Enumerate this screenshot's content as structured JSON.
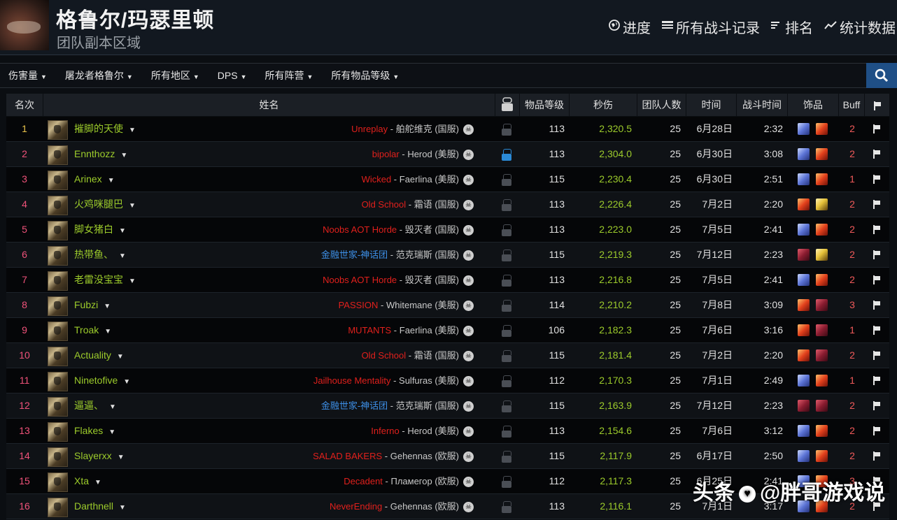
{
  "header": {
    "title": "格鲁尔/玛瑟里顿",
    "subtitle": "团队副本区域",
    "nav": [
      {
        "label": "进度",
        "icon": "globe-icon"
      },
      {
        "label": "所有战斗记录",
        "icon": "list-icon"
      },
      {
        "label": "排名",
        "icon": "ranking-icon"
      },
      {
        "label": "统计数据",
        "icon": "chart-line-icon"
      }
    ]
  },
  "filters": [
    "伤害量",
    "屠龙者格鲁尔",
    "所有地区",
    "DPS",
    "所有阵营",
    "所有物品等级"
  ],
  "table": {
    "columns": [
      "名次",
      "姓名",
      "物品等级",
      "秒伤",
      "团队人数",
      "时间",
      "战斗时间",
      "饰品",
      "Buff"
    ],
    "rows": [
      {
        "rank": "1",
        "name": "摧脚的天使",
        "guild": "Unreplay",
        "server": "舶舵维克 (国服)",
        "video": false,
        "ilvl": "113",
        "dps": "2,320.5",
        "raid": "25",
        "date": "6月28日",
        "fight": "2:32",
        "gems": [
          "blue",
          "red"
        ],
        "buff": "2"
      },
      {
        "rank": "2",
        "name": "Ennthozz",
        "guild": "bipolar",
        "server": "Herod (美服)",
        "video": true,
        "ilvl": "113",
        "dps": "2,304.0",
        "raid": "25",
        "date": "6月30日",
        "fight": "3:08",
        "gems": [
          "blue",
          "red"
        ],
        "buff": "2"
      },
      {
        "rank": "3",
        "name": "Arinex",
        "guild": "Wicked",
        "server": "Faerlina (美服)",
        "video": false,
        "ilvl": "115",
        "dps": "2,230.4",
        "raid": "25",
        "date": "6月30日",
        "fight": "2:51",
        "gems": [
          "blue",
          "red"
        ],
        "buff": "1"
      },
      {
        "rank": "4",
        "name": "火鸡咪腿巴",
        "guild": "Old School",
        "server": "霜语 (国服)",
        "video": false,
        "ilvl": "113",
        "dps": "2,226.4",
        "raid": "25",
        "date": "7月2日",
        "fight": "2:20",
        "gems": [
          "red",
          "yellow"
        ],
        "buff": "2"
      },
      {
        "rank": "5",
        "name": "脚女猪白",
        "guild": "Noobs AOT Horde",
        "server": "毁灭者 (国服)",
        "video": false,
        "ilvl": "113",
        "dps": "2,223.0",
        "raid": "25",
        "date": "7月5日",
        "fight": "2:41",
        "gems": [
          "blue",
          "red"
        ],
        "buff": "2"
      },
      {
        "rank": "6",
        "name": "热带鱼、",
        "guild": "金融世家-神话团",
        "server": "范克瑞斯 (国服)",
        "video": false,
        "ilvl": "115",
        "dps": "2,219.3",
        "raid": "25",
        "date": "7月12日",
        "fight": "2:23",
        "gems": [
          "maroon",
          "yellow"
        ],
        "buff": "2"
      },
      {
        "rank": "7",
        "name": "老雷没宝宝",
        "guild": "Noobs AOT Horde",
        "server": "毁灭者 (国服)",
        "video": false,
        "ilvl": "113",
        "dps": "2,216.8",
        "raid": "25",
        "date": "7月5日",
        "fight": "2:41",
        "gems": [
          "blue",
          "red"
        ],
        "buff": "2"
      },
      {
        "rank": "8",
        "name": "Fubzi",
        "guild": "PASSION",
        "server": "Whitemane (美服)",
        "video": false,
        "ilvl": "114",
        "dps": "2,210.2",
        "raid": "25",
        "date": "7月8日",
        "fight": "3:09",
        "gems": [
          "red",
          "maroon"
        ],
        "buff": "3"
      },
      {
        "rank": "9",
        "name": "Troak",
        "guild": "MUTANTS",
        "server": "Faerlina (美服)",
        "video": false,
        "ilvl": "106",
        "dps": "2,182.3",
        "raid": "25",
        "date": "7月6日",
        "fight": "3:16",
        "gems": [
          "red",
          "maroon"
        ],
        "buff": "1"
      },
      {
        "rank": "10",
        "name": "Actuality",
        "guild": "Old School",
        "server": "霜语 (国服)",
        "video": false,
        "ilvl": "115",
        "dps": "2,181.4",
        "raid": "25",
        "date": "7月2日",
        "fight": "2:20",
        "gems": [
          "red",
          "maroon"
        ],
        "buff": "2"
      },
      {
        "rank": "11",
        "name": "Ninetofive",
        "guild": "Jailhouse Mentality",
        "server": "Sulfuras (美服)",
        "video": false,
        "ilvl": "112",
        "dps": "2,170.3",
        "raid": "25",
        "date": "7月1日",
        "fight": "2:49",
        "gems": [
          "blue",
          "red"
        ],
        "buff": "1"
      },
      {
        "rank": "12",
        "name": "逼逼、",
        "guild": "金融世家-神话团",
        "server": "范克瑞斯 (国服)",
        "video": false,
        "ilvl": "115",
        "dps": "2,163.9",
        "raid": "25",
        "date": "7月12日",
        "fight": "2:23",
        "gems": [
          "maroon",
          "maroon"
        ],
        "buff": "2"
      },
      {
        "rank": "13",
        "name": "Flakes",
        "guild": "Inferno",
        "server": "Herod (美服)",
        "video": false,
        "ilvl": "113",
        "dps": "2,154.6",
        "raid": "25",
        "date": "7月6日",
        "fight": "3:12",
        "gems": [
          "blue",
          "red"
        ],
        "buff": "2"
      },
      {
        "rank": "14",
        "name": "Slayerxx",
        "guild": "SALAD BAKERS",
        "server": "Gehennas (欧服)",
        "video": false,
        "ilvl": "115",
        "dps": "2,117.9",
        "raid": "25",
        "date": "6月17日",
        "fight": "2:50",
        "gems": [
          "blue",
          "red"
        ],
        "buff": "2"
      },
      {
        "rank": "15",
        "name": "Xta",
        "guild": "Decadent",
        "server": "Пламегор (欧服)",
        "video": false,
        "ilvl": "112",
        "dps": "2,117.3",
        "raid": "25",
        "date": "6月25日",
        "fight": "2:41",
        "gems": [
          "blue",
          "red"
        ],
        "buff": "3"
      },
      {
        "rank": "16",
        "name": "Darthnell",
        "guild": "NeverEnding",
        "server": "Gehennas (欧服)",
        "video": false,
        "ilvl": "113",
        "dps": "2,116.1",
        "raid": "25",
        "date": "7月1日",
        "fight": "3:17",
        "gems": [
          "blue",
          "red"
        ],
        "buff": "2"
      }
    ]
  },
  "colors": {
    "name": "#9ccb2b",
    "dps": "#9ccb2b",
    "guild_red": "#e0201c",
    "guild_blue": "#3d8fe6",
    "rank_gold": "#e9c34b",
    "rank_pink": "#f0527a",
    "buff": "#f05a5a",
    "search_button": "#1f4f86"
  },
  "watermark": {
    "prefix": "头条",
    "text": "@胖哥游戏说"
  }
}
